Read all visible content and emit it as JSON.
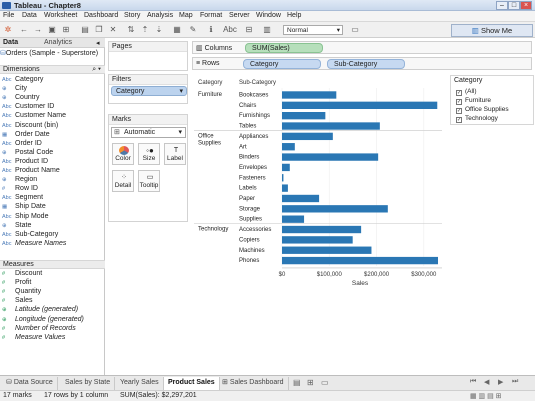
{
  "window": {
    "title": "Tableau - Chapter8",
    "controls": [
      "–",
      "□",
      "×"
    ]
  },
  "menu": [
    "File",
    "Data",
    "Worksheet",
    "Dashboard",
    "Story",
    "Analysis",
    "Map",
    "Format",
    "Server",
    "Window",
    "Help"
  ],
  "toolbar": {
    "fit_select": "Normal",
    "show_me_label": "Show Me"
  },
  "left": {
    "tab_data": "Data",
    "tab_analytics": "Analytics",
    "datasource": "Orders (Sample - Superstore)",
    "dimensions_header": "Dimensions",
    "dimensions": [
      {
        "type": "Abc",
        "name": "Category"
      },
      {
        "type": "⊕",
        "name": "City"
      },
      {
        "type": "⊕",
        "name": "Country"
      },
      {
        "type": "Abc",
        "name": "Customer ID"
      },
      {
        "type": "Abc",
        "name": "Customer Name"
      },
      {
        "type": "Abc",
        "name": "Discount (bin)"
      },
      {
        "type": "▦",
        "name": "Order Date"
      },
      {
        "type": "Abc",
        "name": "Order ID"
      },
      {
        "type": "⊕",
        "name": "Postal Code"
      },
      {
        "type": "Abc",
        "name": "Product ID"
      },
      {
        "type": "Abc",
        "name": "Product Name"
      },
      {
        "type": "⊕",
        "name": "Region"
      },
      {
        "type": "#",
        "name": "Row ID"
      },
      {
        "type": "Abc",
        "name": "Segment"
      },
      {
        "type": "▦",
        "name": "Ship Date"
      },
      {
        "type": "Abc",
        "name": "Ship Mode"
      },
      {
        "type": "⊕",
        "name": "State"
      },
      {
        "type": "Abc",
        "name": "Sub-Category"
      },
      {
        "type": "Abc",
        "name": "Measure Names",
        "italic": true
      }
    ],
    "measures_header": "Measures",
    "measures": [
      {
        "type": "#",
        "name": "Discount"
      },
      {
        "type": "#",
        "name": "Profit"
      },
      {
        "type": "#",
        "name": "Quantity"
      },
      {
        "type": "#",
        "name": "Sales"
      },
      {
        "type": "⊕",
        "name": "Latitude (generated)",
        "italic": true
      },
      {
        "type": "⊕",
        "name": "Longitude (generated)",
        "italic": true
      },
      {
        "type": "#",
        "name": "Number of Records",
        "italic": true
      },
      {
        "type": "#",
        "name": "Measure Values",
        "italic": true
      }
    ]
  },
  "cards": {
    "pages": "Pages",
    "filters": "Filters",
    "filter_pill": "Category",
    "marks": "Marks",
    "mark_type": "Automatic",
    "mark_buttons": [
      "Color",
      "Size",
      "Label",
      "Detail",
      "Tooltip"
    ]
  },
  "shelves": {
    "columns_label": "Columns",
    "columns_pill": "SUM(Sales)",
    "rows_label": "Rows",
    "rows_pills": [
      "Category",
      "Sub-Category"
    ]
  },
  "legend": {
    "title": "Category",
    "items": [
      "(All)",
      "Furniture",
      "Office Supplies",
      "Technology"
    ]
  },
  "chart_data": {
    "type": "bar",
    "row_headers": [
      "Category",
      "Sub-Category"
    ],
    "xlabel": "Sales",
    "xlim": [
      0,
      330000
    ],
    "ticks": [
      {
        "v": 0,
        "t": "$0"
      },
      {
        "v": 100000,
        "t": "$100,000"
      },
      {
        "v": 200000,
        "t": "$200,000"
      },
      {
        "v": 300000,
        "t": "$300,000"
      }
    ],
    "color": "#2a77b4",
    "groups": [
      {
        "category": "Furniture",
        "items": [
          {
            "name": "Bookcases",
            "value": 114880
          },
          {
            "name": "Chairs",
            "value": 328449
          },
          {
            "name": "Furnishings",
            "value": 91705
          },
          {
            "name": "Tables",
            "value": 206966
          }
        ]
      },
      {
        "category": "Office Supplies",
        "items": [
          {
            "name": "Appliances",
            "value": 107532
          },
          {
            "name": "Art",
            "value": 27119
          },
          {
            "name": "Binders",
            "value": 203413
          },
          {
            "name": "Envelopes",
            "value": 16476
          },
          {
            "name": "Fasteners",
            "value": 3024
          },
          {
            "name": "Labels",
            "value": 12486
          },
          {
            "name": "Paper",
            "value": 78479
          },
          {
            "name": "Storage",
            "value": 223844
          },
          {
            "name": "Supplies",
            "value": 46674
          }
        ]
      },
      {
        "category": "Technology",
        "items": [
          {
            "name": "Accessories",
            "value": 167380
          },
          {
            "name": "Copiers",
            "value": 149528
          },
          {
            "name": "Machines",
            "value": 189239
          },
          {
            "name": "Phones",
            "value": 330007
          }
        ]
      }
    ]
  },
  "sheets": [
    "Data Source",
    "Sales by State",
    "Yearly Sales",
    "Product Sales",
    "Sales Dashboard"
  ],
  "active_sheet": "Product Sales",
  "status": {
    "marks": "17 marks",
    "rows": "17 rows by 1 column",
    "sum": "SUM(Sales): $2,297,201"
  }
}
